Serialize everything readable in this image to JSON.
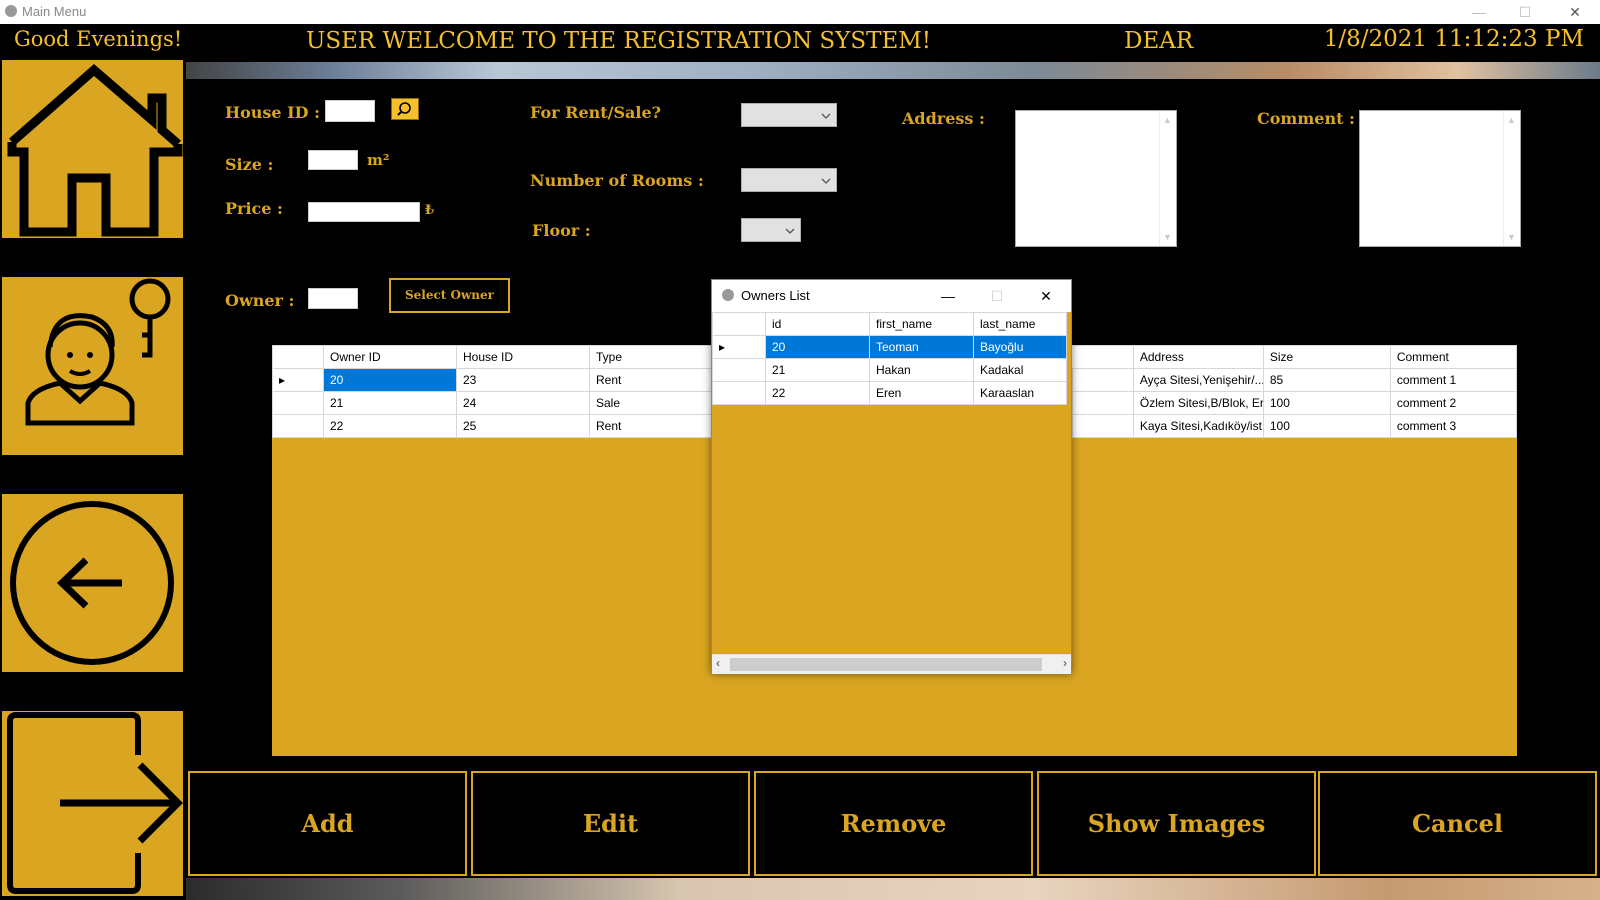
{
  "window": {
    "title": "Main Menu",
    "minimize": "—",
    "maximize": "☐",
    "close": "✕"
  },
  "header": {
    "greeting": "Good Evenings!",
    "welcome": "USER WELCOME TO THE REGISTRATION SYSTEM!",
    "dear": "DEAR",
    "datetime": "1/8/2021 11:12:23 PM"
  },
  "sidebar": {
    "items": [
      "home-icon",
      "owner-icon",
      "back-icon",
      "exit-icon"
    ]
  },
  "form": {
    "house_id_label": "House ID :",
    "size_label": "Size :",
    "size_unit": "m²",
    "price_label": "Price :",
    "price_unit": "₺",
    "owner_label": "Owner :",
    "select_owner": "Select Owner",
    "rent_sale_label": "For Rent/Sale?",
    "rooms_label": "Number of Rooms :",
    "floor_label": "Floor :",
    "address_label": "Address :",
    "comment_label": "Comment :"
  },
  "houses_grid": {
    "columns": [
      "Owner ID",
      "House ID",
      "Type",
      "Address",
      "Size",
      "Comment"
    ],
    "rows": [
      {
        "owner_id": "20",
        "house_id": "23",
        "type": "Rent",
        "address": "Ayça Sitesi,Yenişehir/...",
        "size": "85",
        "comment": "comment 1"
      },
      {
        "owner_id": "21",
        "house_id": "24",
        "type": "Sale",
        "address": "Özlem Sitesi,B/Blok, Er...",
        "size": "100",
        "comment": "comment 2"
      },
      {
        "owner_id": "22",
        "house_id": "25",
        "type": "Rent",
        "address": "Kaya Sitesi,Kadıköy/ist...",
        "size": "100",
        "comment": "comment 3"
      }
    ]
  },
  "buttons": {
    "add": "Add",
    "edit": "Edit",
    "remove": "Remove",
    "show_images": "Show Images",
    "cancel": "Cancel"
  },
  "owners_dialog": {
    "title": "Owners List",
    "columns": [
      "id",
      "first_name",
      "last_name"
    ],
    "rows": [
      {
        "id": "20",
        "first_name": "Teoman",
        "last_name": "Bayoğlu"
      },
      {
        "id": "21",
        "first_name": "Hakan",
        "last_name": "Kadakal"
      },
      {
        "id": "22",
        "first_name": "Eren",
        "last_name": "Karaaslan"
      }
    ]
  },
  "colors": {
    "accent": "#daa520",
    "selection": "#0078d7",
    "background": "#000000"
  }
}
